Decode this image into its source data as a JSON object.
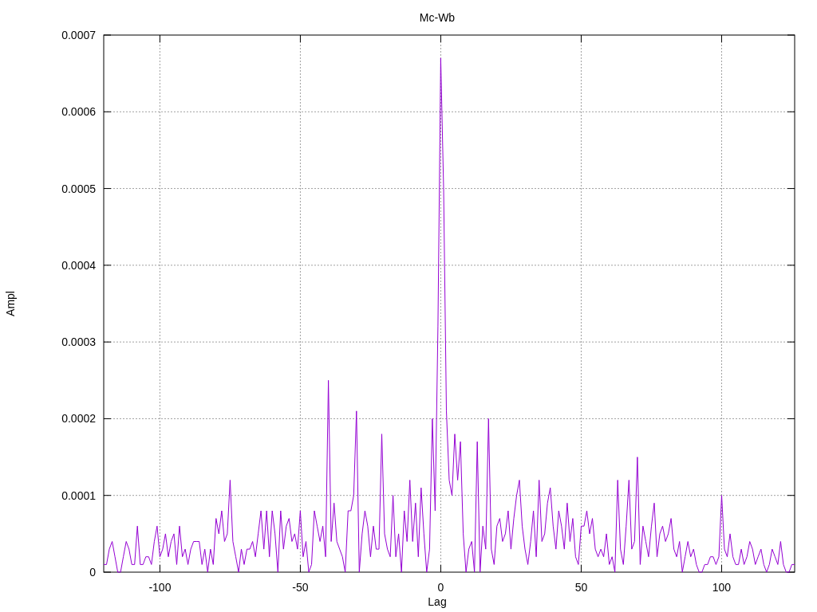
{
  "chart_data": {
    "type": "line",
    "title": "Mc-Wb",
    "xlabel": "Lag",
    "ylabel": "Ampl",
    "xlim": [
      -120,
      126
    ],
    "ylim": [
      0,
      0.0007
    ],
    "xticks": [
      -100,
      -50,
      0,
      50,
      100
    ],
    "yticks": [
      0,
      0.0001,
      0.0002,
      0.0003,
      0.0004,
      0.0005,
      0.0006,
      0.0007
    ],
    "grid": true,
    "x": [
      -120,
      -119,
      -118,
      -117,
      -116,
      -115,
      -114,
      -113,
      -112,
      -111,
      -110,
      -109,
      -108,
      -107,
      -106,
      -105,
      -104,
      -103,
      -102,
      -101,
      -100,
      -99,
      -98,
      -97,
      -96,
      -95,
      -94,
      -93,
      -92,
      -91,
      -90,
      -89,
      -88,
      -87,
      -86,
      -85,
      -84,
      -83,
      -82,
      -81,
      -80,
      -79,
      -78,
      -77,
      -76,
      -75,
      -74,
      -73,
      -72,
      -71,
      -70,
      -69,
      -68,
      -67,
      -66,
      -65,
      -64,
      -63,
      -62,
      -61,
      -60,
      -59,
      -58,
      -57,
      -56,
      -55,
      -54,
      -53,
      -52,
      -51,
      -50,
      -49,
      -48,
      -47,
      -46,
      -45,
      -44,
      -43,
      -42,
      -41,
      -40,
      -39,
      -38,
      -37,
      -36,
      -35,
      -34,
      -33,
      -32,
      -31,
      -30,
      -29,
      -28,
      -27,
      -26,
      -25,
      -24,
      -23,
      -22,
      -21,
      -20,
      -19,
      -18,
      -17,
      -16,
      -15,
      -14,
      -13,
      -12,
      -11,
      -10,
      -9,
      -8,
      -7,
      -6,
      -5,
      -4,
      -3,
      -2,
      -1,
      0,
      1,
      2,
      3,
      4,
      5,
      6,
      7,
      8,
      9,
      10,
      11,
      12,
      13,
      14,
      15,
      16,
      17,
      18,
      19,
      20,
      21,
      22,
      23,
      24,
      25,
      26,
      27,
      28,
      29,
      30,
      31,
      32,
      33,
      34,
      35,
      36,
      37,
      38,
      39,
      40,
      41,
      42,
      43,
      44,
      45,
      46,
      47,
      48,
      49,
      50,
      51,
      52,
      53,
      54,
      55,
      56,
      57,
      58,
      59,
      60,
      61,
      62,
      63,
      64,
      65,
      66,
      67,
      68,
      69,
      70,
      71,
      72,
      73,
      74,
      75,
      76,
      77,
      78,
      79,
      80,
      81,
      82,
      83,
      84,
      85,
      86,
      87,
      88,
      89,
      90,
      91,
      92,
      93,
      94,
      95,
      96,
      97,
      98,
      99,
      100,
      101,
      102,
      103,
      104,
      105,
      106,
      107,
      108,
      109,
      110,
      111,
      112,
      113,
      114,
      115,
      116,
      117,
      118,
      119,
      120,
      121,
      122,
      123,
      124,
      125,
      126
    ],
    "series": [
      {
        "color": "#9400d3",
        "values": [
          1e-05,
          1e-05,
          3e-05,
          4e-05,
          2e-05,
          0,
          0,
          2e-05,
          4e-05,
          3e-05,
          1e-05,
          1e-05,
          6e-05,
          1e-05,
          1e-05,
          2e-05,
          2e-05,
          1e-05,
          4e-05,
          6e-05,
          2e-05,
          3e-05,
          5e-05,
          2e-05,
          4e-05,
          5e-05,
          1e-05,
          6e-05,
          2e-05,
          3e-05,
          1e-05,
          3e-05,
          4e-05,
          4e-05,
          4e-05,
          1e-05,
          3e-05,
          0,
          3e-05,
          1e-05,
          7e-05,
          5e-05,
          8e-05,
          4e-05,
          5e-05,
          0.00012,
          4e-05,
          2e-05,
          0,
          3e-05,
          1e-05,
          3e-05,
          3e-05,
          4e-05,
          2e-05,
          5e-05,
          8e-05,
          3e-05,
          8e-05,
          2e-05,
          8e-05,
          5e-05,
          0,
          8e-05,
          3e-05,
          6e-05,
          7e-05,
          4e-05,
          5e-05,
          3e-05,
          8e-05,
          2e-05,
          4e-05,
          0,
          1e-05,
          8e-05,
          6e-05,
          4e-05,
          6e-05,
          2e-05,
          0.00025,
          4e-05,
          9e-05,
          4e-05,
          3e-05,
          2e-05,
          0,
          8e-05,
          8e-05,
          0.0001,
          0.00021,
          0,
          5e-05,
          8e-05,
          6e-05,
          2e-05,
          6e-05,
          3e-05,
          3e-05,
          0.00018,
          5e-05,
          3e-05,
          2e-05,
          0.0001,
          2e-05,
          5e-05,
          0,
          8e-05,
          4e-05,
          0.00012,
          4e-05,
          9e-05,
          2e-05,
          0.00011,
          5e-05,
          0,
          3e-05,
          0.0002,
          8e-05,
          0.00032,
          0.00067,
          0.0005,
          0.00021,
          0.00012,
          0.0001,
          0.00018,
          0.00012,
          0.00017,
          5e-05,
          0,
          3e-05,
          4e-05,
          0,
          0.00017,
          0,
          6e-05,
          3e-05,
          0.0002,
          3e-05,
          1e-05,
          6e-05,
          7e-05,
          4e-05,
          5e-05,
          8e-05,
          3e-05,
          7e-05,
          0.0001,
          0.00012,
          6e-05,
          3e-05,
          1e-05,
          4e-05,
          8e-05,
          2e-05,
          0.00012,
          4e-05,
          5e-05,
          9e-05,
          0.00011,
          6e-05,
          3e-05,
          8e-05,
          6e-05,
          3e-05,
          9e-05,
          4e-05,
          7e-05,
          2e-05,
          1e-05,
          6e-05,
          6e-05,
          8e-05,
          5e-05,
          7e-05,
          3e-05,
          2e-05,
          3e-05,
          2e-05,
          5e-05,
          1e-05,
          2e-05,
          0,
          0.00012,
          3e-05,
          1e-05,
          6e-05,
          0.00012,
          3e-05,
          4e-05,
          0.00015,
          1e-05,
          6e-05,
          4e-05,
          2e-05,
          6e-05,
          9e-05,
          2e-05,
          5e-05,
          6e-05,
          4e-05,
          5e-05,
          7e-05,
          3e-05,
          2e-05,
          4e-05,
          0,
          2e-05,
          4e-05,
          2e-05,
          3e-05,
          1e-05,
          0,
          0,
          1e-05,
          1e-05,
          2e-05,
          2e-05,
          1e-05,
          2e-05,
          0.0001,
          3e-05,
          2e-05,
          5e-05,
          2e-05,
          1e-05,
          1e-05,
          3e-05,
          1e-05,
          2e-05,
          4e-05,
          3e-05,
          1e-05,
          2e-05,
          3e-05,
          1e-05,
          0,
          1e-05,
          3e-05,
          2e-05,
          1e-05,
          4e-05,
          1e-05,
          0,
          0,
          1e-05,
          1e-05
        ]
      }
    ]
  }
}
